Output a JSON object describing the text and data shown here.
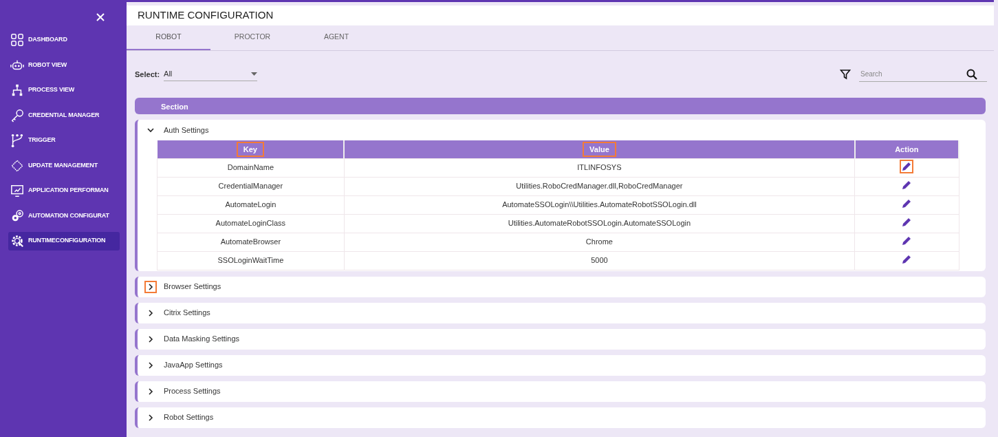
{
  "sidebar": {
    "items": [
      {
        "label": "DASHBOARD",
        "kind": "grid",
        "selected": false
      },
      {
        "label": "ROBOT VIEW",
        "kind": "robot",
        "selected": false
      },
      {
        "label": "PROCESS VIEW",
        "kind": "hierarchy",
        "selected": false
      },
      {
        "label": "CREDENTIAL MANAGER",
        "kind": "key",
        "selected": false
      },
      {
        "label": "TRIGGER",
        "kind": "branch",
        "selected": false
      },
      {
        "label": "UPDATE MANAGEMENT",
        "kind": "chip",
        "selected": false
      },
      {
        "label": "APPLICATION PERFORMAN",
        "kind": "monitor",
        "selected": false
      },
      {
        "label": "AUTOMATION CONFIGURAT",
        "kind": "gears",
        "selected": false
      },
      {
        "label": "RUNTIMECONFIGURATION",
        "kind": "wrench-gear",
        "selected": true
      }
    ]
  },
  "page_title": "RUNTIME CONFIGURATION",
  "tabs": [
    {
      "label": "ROBOT",
      "selected": true
    },
    {
      "label": "PROCTOR",
      "selected": false
    },
    {
      "label": "AGENT",
      "selected": false
    }
  ],
  "filter": {
    "label": "Select:",
    "value": "All"
  },
  "search": {
    "placeholder": "Search"
  },
  "section_header": "Section",
  "sections": [
    {
      "title": "Auth Settings",
      "expanded": true,
      "highlighted": false,
      "columns": [
        {
          "label": "Key",
          "highlighted": true
        },
        {
          "label": "Value",
          "highlighted": true
        },
        {
          "label": "Action",
          "highlighted": false
        }
      ],
      "rows": [
        {
          "key": "DomainName",
          "value": "ITLINFOSYS",
          "highlighted": true
        },
        {
          "key": "CredentialManager",
          "value": "Utilities.RoboCredManager.dll,RoboCredManager",
          "highlighted": false
        },
        {
          "key": "AutomateLogin",
          "value": "AutomateSSOLogin\\\\Utilities.AutomateRobotSSOLogin.dll",
          "highlighted": false
        },
        {
          "key": "AutomateLoginClass",
          "value": "Utilities.AutomateRobotSSOLogin.AutomateSSOLogin",
          "highlighted": false
        },
        {
          "key": "AutomateBrowser",
          "value": "Chrome",
          "highlighted": false
        },
        {
          "key": "SSOLoginWaitTime",
          "value": "5000",
          "highlighted": false
        }
      ]
    },
    {
      "title": "Browser Settings",
      "expanded": false,
      "highlighted": true
    },
    {
      "title": "Citrix Settings",
      "expanded": false,
      "highlighted": false
    },
    {
      "title": "Data Masking Settings",
      "expanded": false,
      "highlighted": false
    },
    {
      "title": "JavaApp Settings",
      "expanded": false,
      "highlighted": false
    },
    {
      "title": "Process Settings",
      "expanded": false,
      "highlighted": false
    },
    {
      "title": "Robot Settings",
      "expanded": false,
      "highlighted": false
    }
  ]
}
